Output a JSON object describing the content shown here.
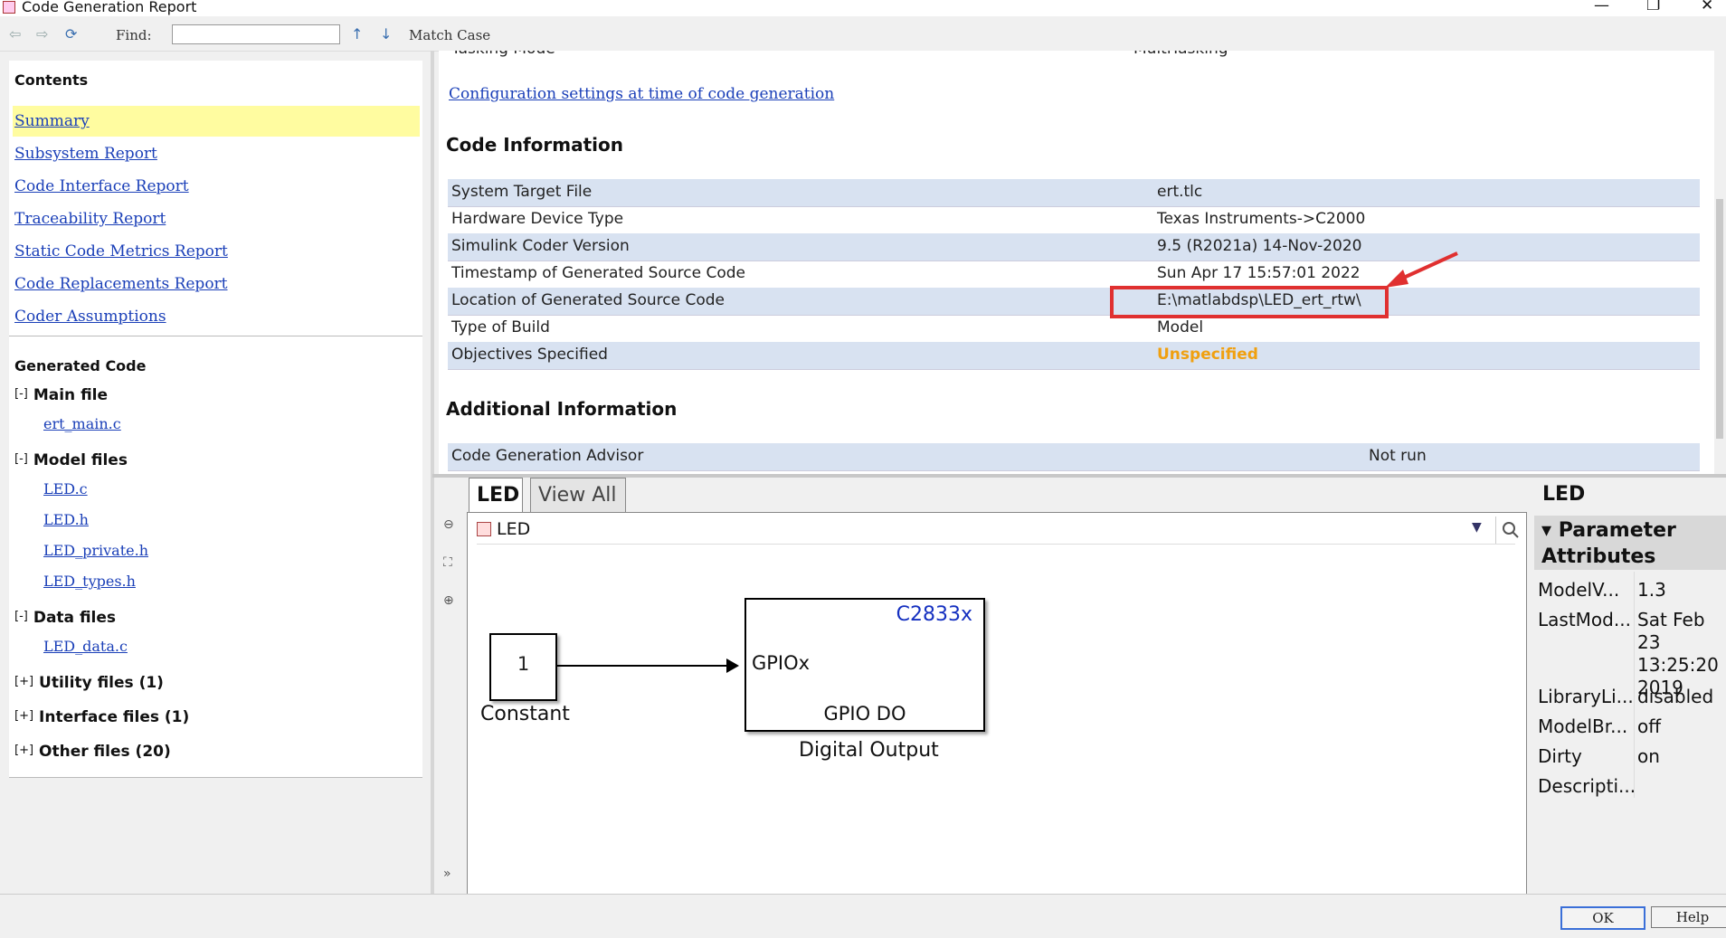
{
  "window": {
    "title": "Code Generation Report",
    "minimize": "—",
    "maximize": "❐",
    "close": "✕"
  },
  "toolbar": {
    "back": "⇦",
    "forward": "⇨",
    "refresh": "⟳",
    "find_label": "Find:",
    "find_value": "",
    "up": "↑",
    "down": "↓",
    "match_case": "Match Case"
  },
  "nav": {
    "contents_heading": "Contents",
    "items": [
      "Summary",
      "Subsystem Report",
      "Code Interface Report",
      "Traceability Report",
      "Static Code Metrics Report",
      "Code Replacements Report",
      "Coder Assumptions"
    ],
    "generated_heading": "Generated Code",
    "groups": {
      "main": {
        "toggle": "[-]",
        "label": "Main file",
        "files": [
          "ert_main.c"
        ]
      },
      "model": {
        "toggle": "[-]",
        "label": "Model files",
        "files": [
          "LED.c",
          "LED.h",
          "LED_private.h",
          "LED_types.h"
        ]
      },
      "data": {
        "toggle": "[-]",
        "label": "Data files",
        "files": [
          "LED_data.c"
        ]
      },
      "utility": {
        "toggle": "[+]",
        "label": "Utility files (1)"
      },
      "interface": {
        "toggle": "[+]",
        "label": "Interface files (1)"
      },
      "other": {
        "toggle": "[+]",
        "label": "Other files (20)"
      }
    }
  },
  "report": {
    "partial_row": {
      "key": "Tasking Mode",
      "value": "MultiTasking"
    },
    "config_link": "Configuration settings at time of code generation",
    "code_info_title": "Code Information",
    "code_info": [
      {
        "key": "System Target File",
        "value": "ert.tlc"
      },
      {
        "key": "Hardware Device Type",
        "value": "Texas Instruments->C2000"
      },
      {
        "key": "Simulink Coder Version",
        "value": "9.5 (R2021a) 14-Nov-2020"
      },
      {
        "key": "Timestamp of Generated Source Code",
        "value": "Sun Apr 17 15:57:01 2022"
      },
      {
        "key": "Location of Generated Source Code",
        "value": "E:\\matlabdsp\\LED_ert_rtw\\"
      },
      {
        "key": "Type of Build",
        "value": "Model"
      },
      {
        "key": "Objectives Specified",
        "value": "Unspecified"
      }
    ],
    "additional_title": "Additional Information",
    "additional": [
      {
        "key": "Code Generation Advisor",
        "value": "Not run"
      }
    ],
    "highlight_color": "#e03030",
    "unspecified_color": "#f0a010"
  },
  "diagram": {
    "tabs": [
      "LED",
      "View All"
    ],
    "address": "LED",
    "tools": [
      "⊖",
      "⛶",
      "⊕",
      "»"
    ],
    "constant": {
      "value": "1",
      "name": "Constant"
    },
    "digital": {
      "tag": "C2833x",
      "port": "GPIOx",
      "label": "GPIO DO",
      "name": "Digital Output"
    }
  },
  "inspector": {
    "title": "LED",
    "section": "Parameter Attributes",
    "rows": [
      {
        "key": "ModelV...",
        "value": "1.3"
      },
      {
        "key": "LastMod...",
        "value": "Sat Feb 23 13:25:20 2019"
      },
      {
        "key": "LibraryLi...",
        "value": "disabled"
      },
      {
        "key": "ModelBr...",
        "value": "off"
      },
      {
        "key": "Dirty",
        "value": "on"
      },
      {
        "key": "Descripti...",
        "value": ""
      }
    ]
  },
  "buttons": {
    "ok": "OK",
    "help": "Help"
  }
}
